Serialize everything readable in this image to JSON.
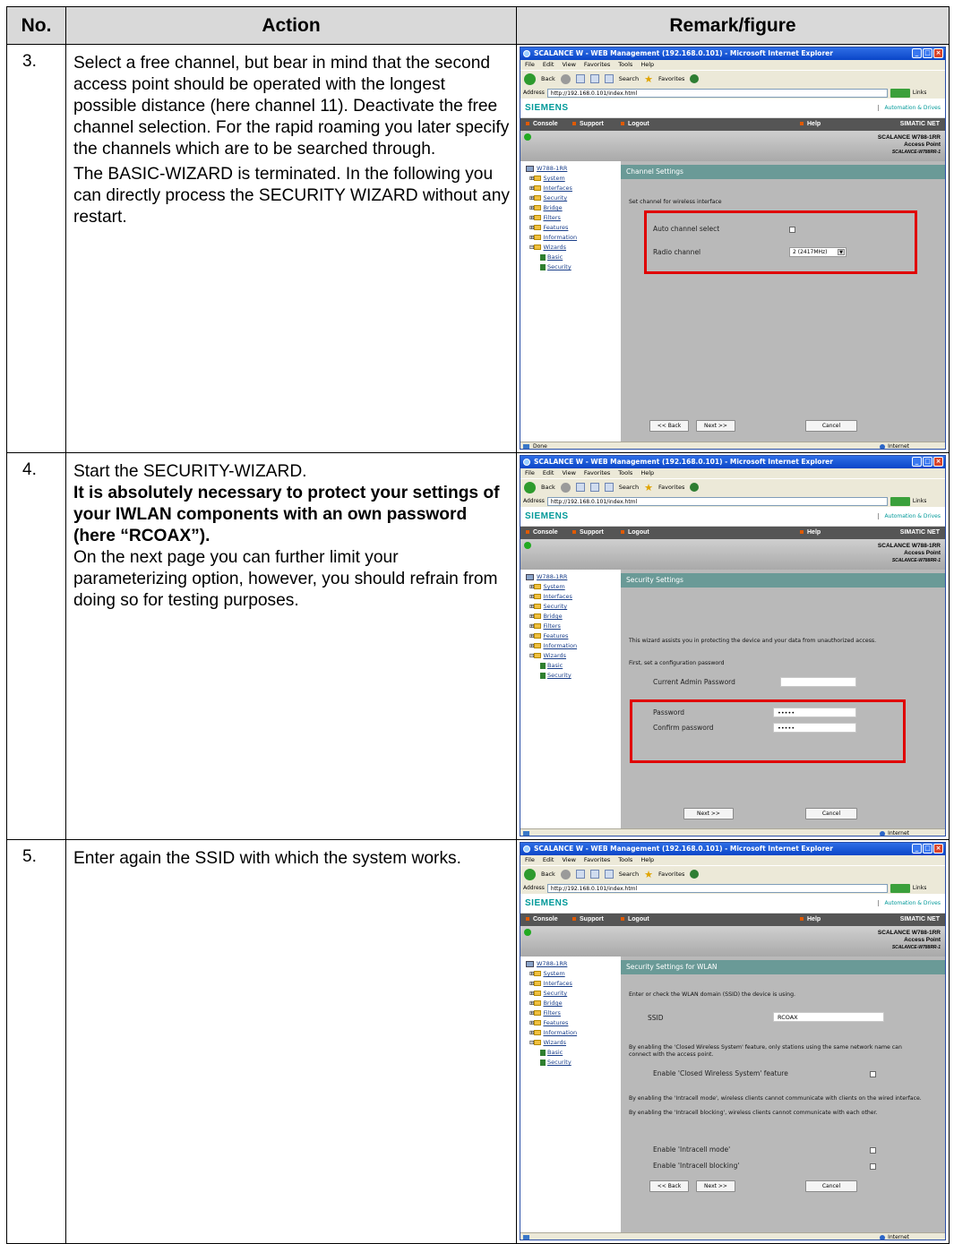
{
  "table": {
    "headers": {
      "no": "No.",
      "action": "Action",
      "remark": "Remark/figure"
    }
  },
  "rows": [
    {
      "no": "3.",
      "action": [
        "Select a free channel, but bear in mind that the second access point should be operated with the longest possible distance (here channel 11). Deactivate the free channel selection. For the rapid roaming you later specify the channels which are to be searched through.",
        "The BASIC-WIZARD is terminated. In the following you can directly process the SECURITY WIZARD without any restart."
      ],
      "shot": {
        "page_title": "Channel Settings",
        "intro": "Set channel for wireless interface",
        "auto_channel_label": "Auto channel select",
        "radio_channel_label": "Radio channel",
        "radio_channel_value": "2 (2417MHz)",
        "back_button": "<< Back",
        "next_button": "Next >>",
        "cancel_button": "Cancel",
        "status_text": "Done",
        "zone_text": "Internet"
      }
    },
    {
      "no": "4.",
      "action_plain_1": "Start the SECURITY-WIZARD.",
      "action_bold": "It is absolutely necessary to protect your settings of your IWLAN components with an own password (here “RCOAX”).",
      "action_plain_2": "On the next page you can further limit your parameterizing option, however, you should refrain from doing so for testing purposes.",
      "shot": {
        "page_title": "Security Settings",
        "intro": "This wizard assists you in protecting the device and your data from unauthorized access.",
        "intro2": "First, set a configuration password",
        "current_pw_label": "Current Admin Password",
        "password_label": "Password",
        "password_value": "•••••",
        "confirm_label": "Confirm password",
        "confirm_value": "•••••",
        "next_button": "Next >>",
        "cancel_button": "Cancel",
        "zone_text": "Internet"
      }
    },
    {
      "no": "5.",
      "action": "Enter again the SSID with which the system works.",
      "shot": {
        "page_title": "Security Settings for WLAN",
        "intro": "Enter or check the WLAN domain (SSID) the device is using.",
        "ssid_label": "SSID",
        "ssid_value": "RCOAX",
        "closed_text": "By enabling the 'Closed Wireless System' feature, only stations using the same network name can connect with the access point.",
        "closed_label": "Enable 'Closed Wireless System' feature",
        "intracell_text1": "By enabling the 'Intracell mode', wireless clients cannot communicate with clients on the wired interface.",
        "intracell_text2": "By enabling the 'Intracell blocking', wireless clients cannot communicate with each other.",
        "intracell_mode_label": "Enable 'Intracell mode'",
        "intracell_block_label": "Enable 'Intracell blocking'",
        "back_button": "<< Back",
        "next_button": "Next >>",
        "cancel_button": "Cancel",
        "zone_text": "Internet"
      }
    }
  ],
  "browser": {
    "window_title": "SCALANCE W - WEB Management (192.168.0.101) - Microsoft Internet Explorer",
    "menu": [
      "File",
      "Edit",
      "View",
      "Favorites",
      "Tools",
      "Help"
    ],
    "back_label": "Back",
    "search_label": "Search",
    "favorites_label": "Favorites",
    "address_label": "Address",
    "address_value": "http://192.168.0.101/index.html",
    "go_label": "Go",
    "links_label": "Links"
  },
  "webui": {
    "brand": "SIEMENS",
    "tagline": "Automation & Drives",
    "nav": {
      "console": "Console",
      "support": "Support",
      "logout": "Logout",
      "help": "Help",
      "product_line": "SIMATIC NET"
    },
    "device_name": "SCALANCE W788-1RR",
    "device_type": "Access Point",
    "device_model": "SCALANCE-W788RR-1",
    "tree": {
      "root": "W788-1RR",
      "items": [
        "System",
        "Interfaces",
        "Security",
        "Bridge",
        "Filters",
        "Features",
        "Information",
        "Wizards"
      ],
      "sub_items": [
        "Basic",
        "Security"
      ]
    }
  },
  "colors": {
    "highlight_box": "#e00000",
    "siemens_teal": "#009999",
    "header_shade": "#d9d9d9"
  }
}
